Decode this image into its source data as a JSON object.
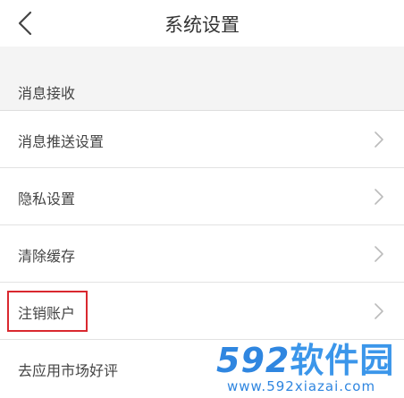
{
  "header": {
    "title": "系统设置"
  },
  "section": {
    "title": "消息接收"
  },
  "settings": {
    "items": [
      {
        "label": "消息推送设置"
      },
      {
        "label": "隐私设置"
      },
      {
        "label": "清除缓存"
      },
      {
        "label": "注销账户"
      },
      {
        "label": "去应用市场好评"
      }
    ]
  },
  "watermark": {
    "number": "592",
    "brand": "软件园",
    "url": "www.592xiazai.com"
  },
  "colors": {
    "highlight": "#d9282f",
    "watermark": "#2f86e0",
    "section_bg": "#f4f4f4"
  }
}
